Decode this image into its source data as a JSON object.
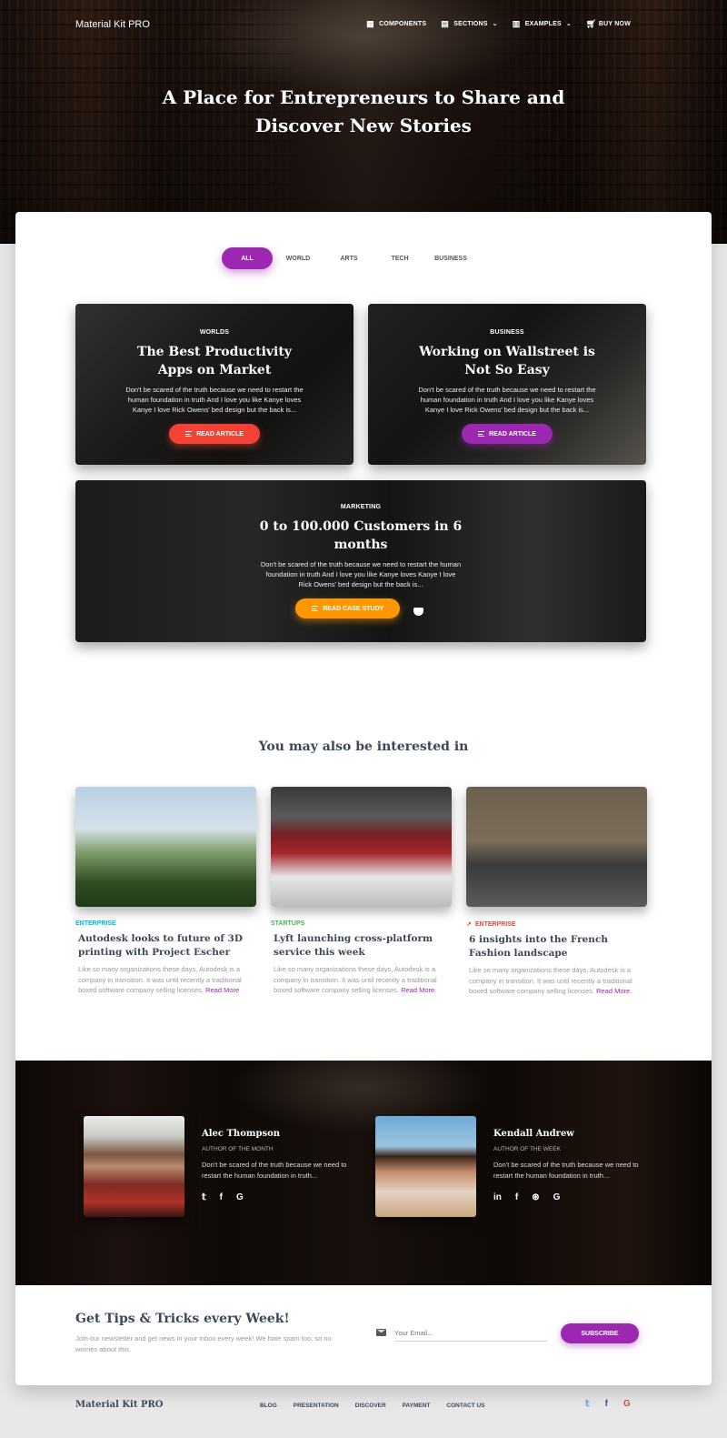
{
  "nav": {
    "brand": "Material Kit PRO",
    "links": [
      {
        "label": "COMPONENTS",
        "icon": "apps-icon"
      },
      {
        "label": "SECTIONS",
        "icon": "sections-icon"
      },
      {
        "label": "EXAMPLES",
        "icon": "examples-icon"
      },
      {
        "label": "BUY NOW",
        "icon": "cart-icon"
      }
    ]
  },
  "hero": {
    "title": "A Place for Entrepreneurs to Share and Discover New Stories"
  },
  "tabs": [
    "ALL",
    "WORLD",
    "ARTS",
    "TECH",
    "BUSINESS"
  ],
  "featured": [
    {
      "category": "WORLDS",
      "title": "The Best Productivity Apps on Market",
      "description": "Don't be scared of the truth because we need to restart the human foundation in truth And I love you like Kanye loves Kanye I love Rick Owens' bed design but the back is...",
      "button": "READ ARTICLE",
      "button_color": "#f44336"
    },
    {
      "category": "BUSINESS",
      "title": "Working on Wallstreet is Not So Easy",
      "description": "Don't be scared of the truth because we need to restart the human foundation in truth And I love you like Kanye loves Kanye I love Rick Owens' bed design but the back is...",
      "button": "READ ARTICLE",
      "button_color": "#9c27b0"
    },
    {
      "category": "MARKETING",
      "title": "0 to 100.000 Customers in 6 months",
      "description": "Don't be scared of the truth because we need to restart the human foundation in truth And I love you like Kanye loves Kanye I love Rick Owens' bed design but the back is...",
      "button": "READ CASE STUDY",
      "button_color": "#ff9800"
    }
  ],
  "interest": {
    "title": "You may also be interested in",
    "posts": [
      {
        "category": "ENTERPRISE",
        "category_color": "#00bcd4",
        "title": "Autodesk looks to future of 3D printing with Project Escher",
        "description": "Like so many organizations these days, Autodesk is a company in transition. It was until recently a traditional boxed software company selling licenses.",
        "more": "Read More"
      },
      {
        "category": "STARTUPS",
        "category_color": "#4caf50",
        "title": "Lyft launching cross-platform service this week",
        "description": "Like so many organizations these days, Autodesk is a company in transition. It was until recently a traditional boxed software company selling licenses.",
        "more": "Read More"
      },
      {
        "category": "ENTERPRISE",
        "category_color": "#f44336",
        "title": "6 insights into the French Fashion landscape",
        "description": "Like so many organizations these days, Autodesk is a company in transition. It was until recently a traditional boxed software company selling licenses.",
        "more": "Read More"
      }
    ]
  },
  "authors": [
    {
      "name": "Alec Thompson",
      "role": "AUTHOR OF THE MONTH",
      "bio": "Don't be scared of the truth because we need to restart the human foundation in truth...",
      "social": [
        "twitter-icon",
        "facebook-icon",
        "google-icon"
      ]
    },
    {
      "name": "Kendall Andrew",
      "role": "AUTHOR OF THE WEEK",
      "bio": "Don't be scared of the truth because we need to restart the human foundation in truth...",
      "social": [
        "linkedin-icon",
        "facebook-icon",
        "dribbble-icon",
        "google-icon"
      ]
    }
  ],
  "newsletter": {
    "title": "Get Tips & Tricks every Week!",
    "description": "Join our newsletter and get news in your inbox every week! We hate spam too, so no worries about this.",
    "placeholder": "Your Email...",
    "button": "SUBSCRIBE"
  },
  "footer": {
    "brand": "Material Kit PRO",
    "links": [
      "BLOG",
      "PRESENTATION",
      "DISCOVER",
      "PAYMENT",
      "CONTACT US"
    ],
    "social": [
      {
        "icon": "twitter-icon",
        "color": "#55acee"
      },
      {
        "icon": "facebook-icon",
        "color": "#3b5998"
      },
      {
        "icon": "google-icon",
        "color": "#dd4b39"
      }
    ]
  }
}
